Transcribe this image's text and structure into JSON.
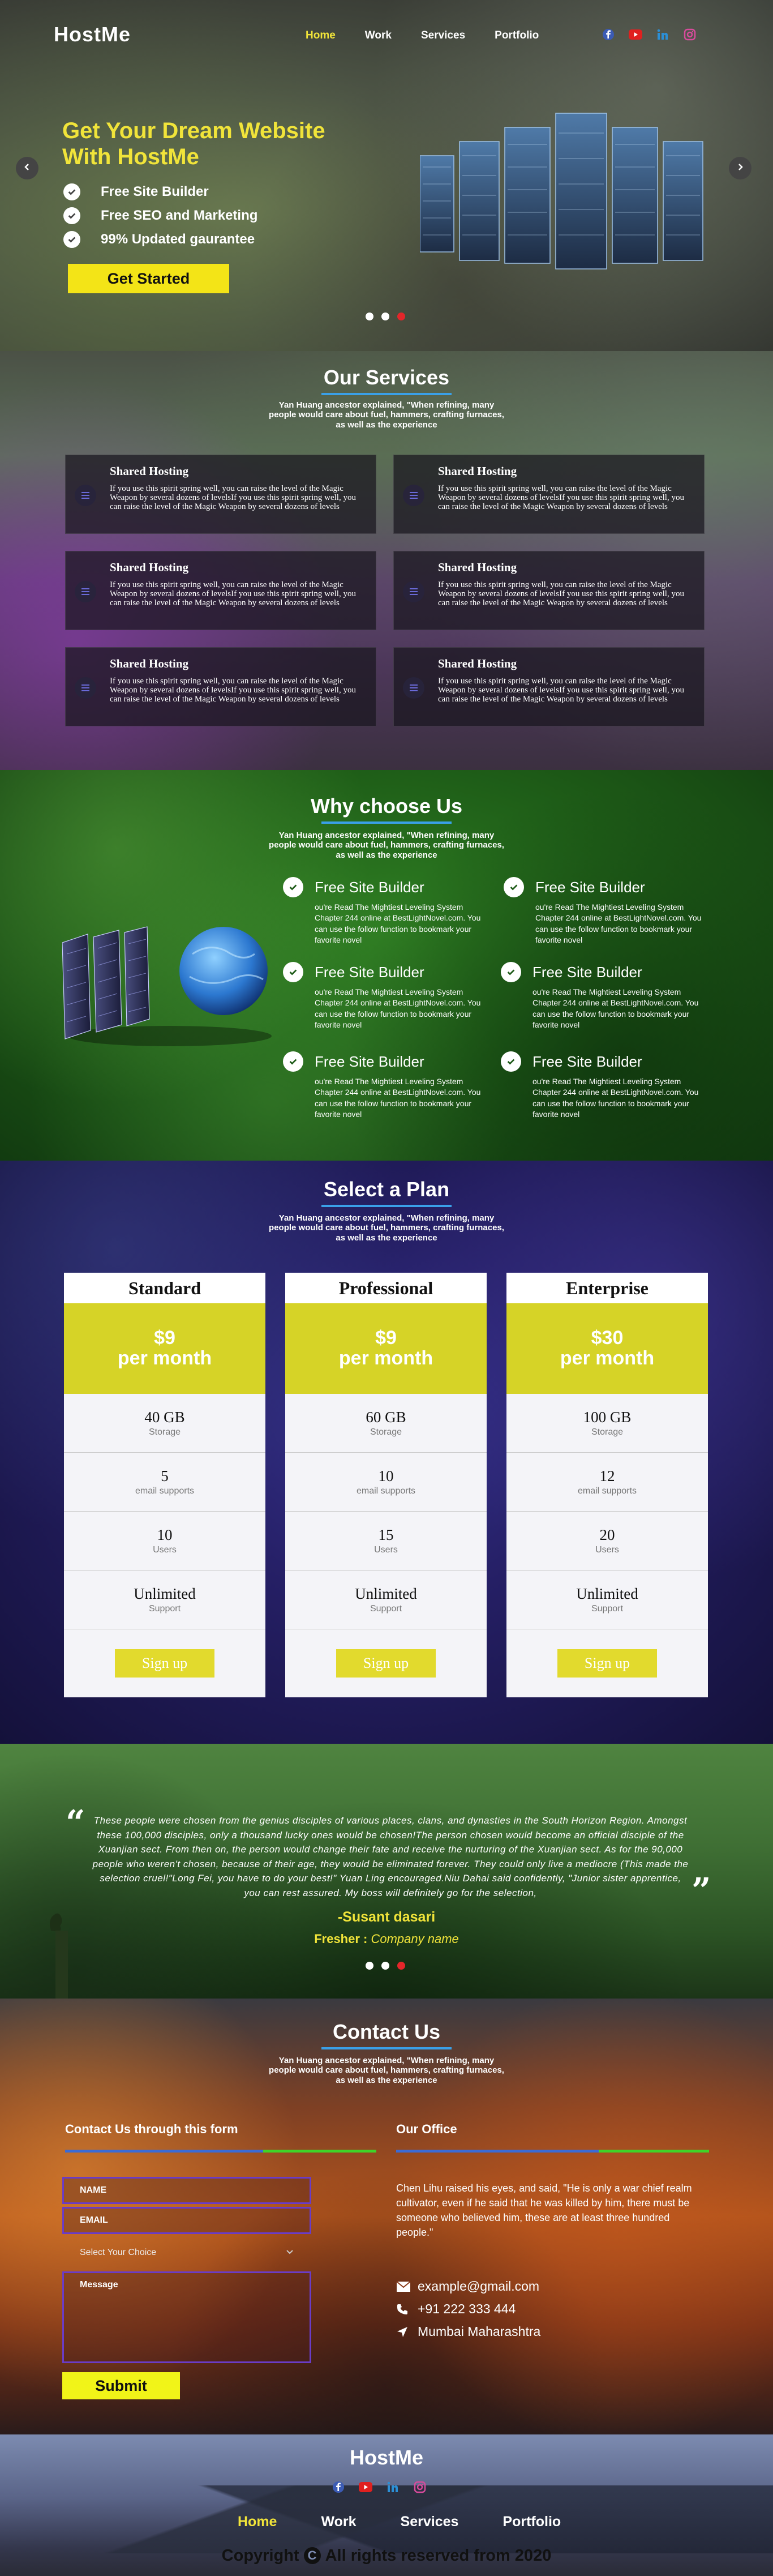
{
  "brand": "HostMe",
  "nav": {
    "items": [
      "Home",
      "Work",
      "Services",
      "Portfolio"
    ]
  },
  "social": [
    "facebook-icon",
    "youtube-icon",
    "linkedin-icon",
    "instagram-icon"
  ],
  "colors": {
    "accent_yellow": "#f1e43a",
    "accent_blue": "#3aa0e8",
    "slider_active": "#e3262a"
  },
  "hero": {
    "title": "Get Your Dream Website With HostMe",
    "features": [
      "Free Site Builder",
      "Free SEO and Marketing",
      "99% Updated gaurantee"
    ],
    "cta": "Get Started"
  },
  "services": {
    "title": "Our Services",
    "subtitle": "Yan Huang ancestor explained, \"When refining, many people would care about fuel, hammers, crafting furnaces, as well as the experience",
    "cards": [
      {
        "title": "Shared Hosting",
        "text": "If you use this spirit spring well, you can raise the level of the Magic Weapon by several dozens of levelsIf you use this spirit spring well, you can raise the level of the Magic Weapon by several dozens of levels"
      },
      {
        "title": "Shared Hosting",
        "text": "If you use this spirit spring well, you can raise the level of the Magic Weapon by several dozens of levelsIf you use this spirit spring well, you can raise the level of the Magic Weapon by several dozens of levels"
      },
      {
        "title": "Shared Hosting",
        "text": "If you use this spirit spring well, you can raise the level of the Magic Weapon by several dozens of levelsIf you use this spirit spring well, you can raise the level of the Magic Weapon by several dozens of levels"
      },
      {
        "title": "Shared Hosting",
        "text": "If you use this spirit spring well, you can raise the level of the Magic Weapon by several dozens of levelsIf you use this spirit spring well, you can raise the level of the Magic Weapon by several dozens of levels"
      },
      {
        "title": "Shared Hosting",
        "text": "If you use this spirit spring well, you can raise the level of the Magic Weapon by several dozens of levelsIf you use this spirit spring well, you can raise the level of the Magic Weapon by several dozens of levels"
      },
      {
        "title": "Shared Hosting",
        "text": "If you use this spirit spring well, you can raise the level of the Magic Weapon by several dozens of levelsIf you use this spirit spring well, you can raise the level of the Magic Weapon by several dozens of levels"
      }
    ]
  },
  "why": {
    "title": "Why choose Us",
    "subtitle": "Yan Huang ancestor explained, \"When refining, many people would care about fuel, hammers, crafting furnaces, as well as the experience",
    "items": [
      {
        "title": "Free Site Builder",
        "text": "ou're Read The Mightiest Leveling System Chapter 244 online at BestLightNovel.com. You can use the follow function to bookmark your favorite novel"
      },
      {
        "title": "Free Site Builder",
        "text": "ou're Read The Mightiest Leveling System Chapter 244 online at BestLightNovel.com. You can use the follow function to bookmark your favorite novel"
      },
      {
        "title": "Free Site Builder",
        "text": "ou're Read The Mightiest Leveling System Chapter 244 online at BestLightNovel.com. You can use the follow function to bookmark your favorite novel"
      },
      {
        "title": "Free Site Builder",
        "text": "ou're Read The Mightiest Leveling System Chapter 244 online at BestLightNovel.com. You can use the follow function to bookmark your favorite novel"
      },
      {
        "title": "Free Site Builder",
        "text": "ou're Read The Mightiest Leveling System Chapter 244 online at BestLightNovel.com. You can use the follow function to bookmark your favorite novel"
      },
      {
        "title": "Free Site Builder",
        "text": "ou're Read The Mightiest Leveling System Chapter 244 online at BestLightNovel.com. You can use the follow function to bookmark your favorite novel"
      }
    ]
  },
  "plans": {
    "title": "Select a Plan",
    "subtitle": "Yan Huang ancestor explained, \"When refining, many people would care about fuel, hammers, crafting furnaces, as well as the experience",
    "cards": [
      {
        "name": "Standard",
        "price": "$9",
        "period": "per month",
        "rows": [
          {
            "v": "40 GB",
            "l": "Storage"
          },
          {
            "v": "5",
            "l": "email supports"
          },
          {
            "v": "10",
            "l": "Users"
          },
          {
            "v": "Unlimited",
            "l": "Support"
          }
        ],
        "button": "Sign up"
      },
      {
        "name": "Professional",
        "price": "$9",
        "period": "per month",
        "rows": [
          {
            "v": "60 GB",
            "l": "Storage"
          },
          {
            "v": "10",
            "l": "email supports"
          },
          {
            "v": "15",
            "l": "Users"
          },
          {
            "v": "Unlimited",
            "l": "Support"
          }
        ],
        "button": "Sign up"
      },
      {
        "name": "Enterprise",
        "price": "$30",
        "period": "per month",
        "rows": [
          {
            "v": "100 GB",
            "l": "Storage"
          },
          {
            "v": "12",
            "l": "email supports"
          },
          {
            "v": "20",
            "l": "Users"
          },
          {
            "v": "Unlimited",
            "l": "Support"
          }
        ],
        "button": "Sign up"
      }
    ]
  },
  "testimonial": {
    "quote": "These people were chosen from the genius disciples of various places, clans, and dynasties in the South Horizon Region. Amongst these 100,000 disciples, only a thousand lucky ones would be chosen!The person chosen would become an official disciple of the Xuanjian sect. From then on, the person would change their fate and receive the nurturing of the Xuanjian sect. As for the 90,000 people who weren't chosen, because of their age, they would be eliminated forever. They could only live a mediocre (This made the selection cruel!\"Long Fei, you have to do your best!\" Yuan Ling encouraged.Niu Dahai said confidently, \"Junior sister apprentice, you can rest assured. My boss will definitely go for the selection,",
    "name": "-Susant dasari",
    "role_label": "Fresher :",
    "role_company": "Company name"
  },
  "contact": {
    "title": "Contact Us",
    "subtitle": "Yan Huang ancestor explained, \"When refining, many people would care about fuel, hammers, crafting furnaces, as well as the experience",
    "form_title": "Contact Us through this form",
    "name_placeholder": "NAME",
    "email_placeholder": "EMAIL",
    "select_label": "Select Your Choice",
    "message_placeholder": "Message",
    "submit": "Submit",
    "office_title": "Our Office",
    "office_text": "Chen Lihu raised his eyes, and said, \"He is only a war chief realm cultivator, even if he said that he was killed by him, there must be someone who believed him, these are at least three hundred people.\"",
    "email": "example@gmail.com",
    "phone": "+91 222 333 444",
    "location": "Mumbai Maharashtra"
  },
  "footer": {
    "logo": "HostMe",
    "menu": [
      "Home",
      "Work",
      "Services",
      "Portfolio"
    ],
    "copyright_pre": "Copyright",
    "copyright_symbol": "C",
    "copyright_post": "All rights reserved from 2020"
  }
}
